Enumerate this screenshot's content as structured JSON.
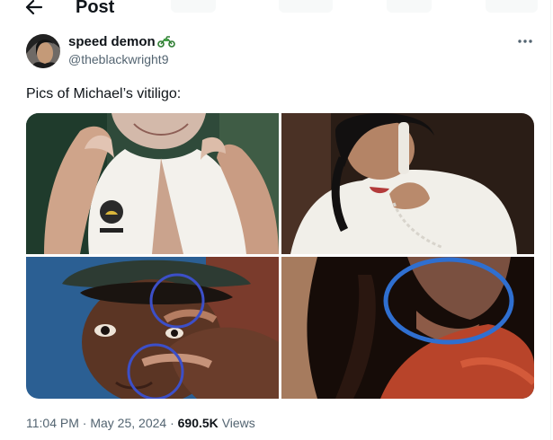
{
  "header": {
    "title": "Post"
  },
  "tweet": {
    "author": {
      "display_name": "speed demon",
      "handle": "@theblackwright9"
    },
    "text": "Pics of Michael’s vitiligo:",
    "time": "11:04 PM",
    "separator": "·",
    "date": "May 25, 2024",
    "views_count": "690.5K",
    "views_label": "Views"
  },
  "icons": [
    "back-arrow-icon",
    "motorcycle-icon",
    "more-icon"
  ],
  "colors": {
    "text": "#0f1419",
    "secondary": "#536471",
    "annotation_circle": "#3c4fc8"
  }
}
